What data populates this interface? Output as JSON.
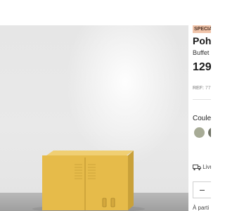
{
  "product": {
    "badge": "SPECIA",
    "title": "Poh",
    "subtitle": "Buffet",
    "price": "129,",
    "ref_label": "REF:",
    "ref_value": "775",
    "color_label": "Couleu",
    "swatches": [
      {
        "name": "sage",
        "color": "#a7ab96"
      },
      {
        "name": "olive-grey",
        "color": "#6f7266"
      }
    ],
    "delivery_text": "Livr",
    "from_text": "À parti"
  },
  "colors": {
    "badge_bg": "#f0c4aa",
    "cabinet_yellow": "#e6bb4a",
    "gallery_bg": "#e8e8e8"
  }
}
